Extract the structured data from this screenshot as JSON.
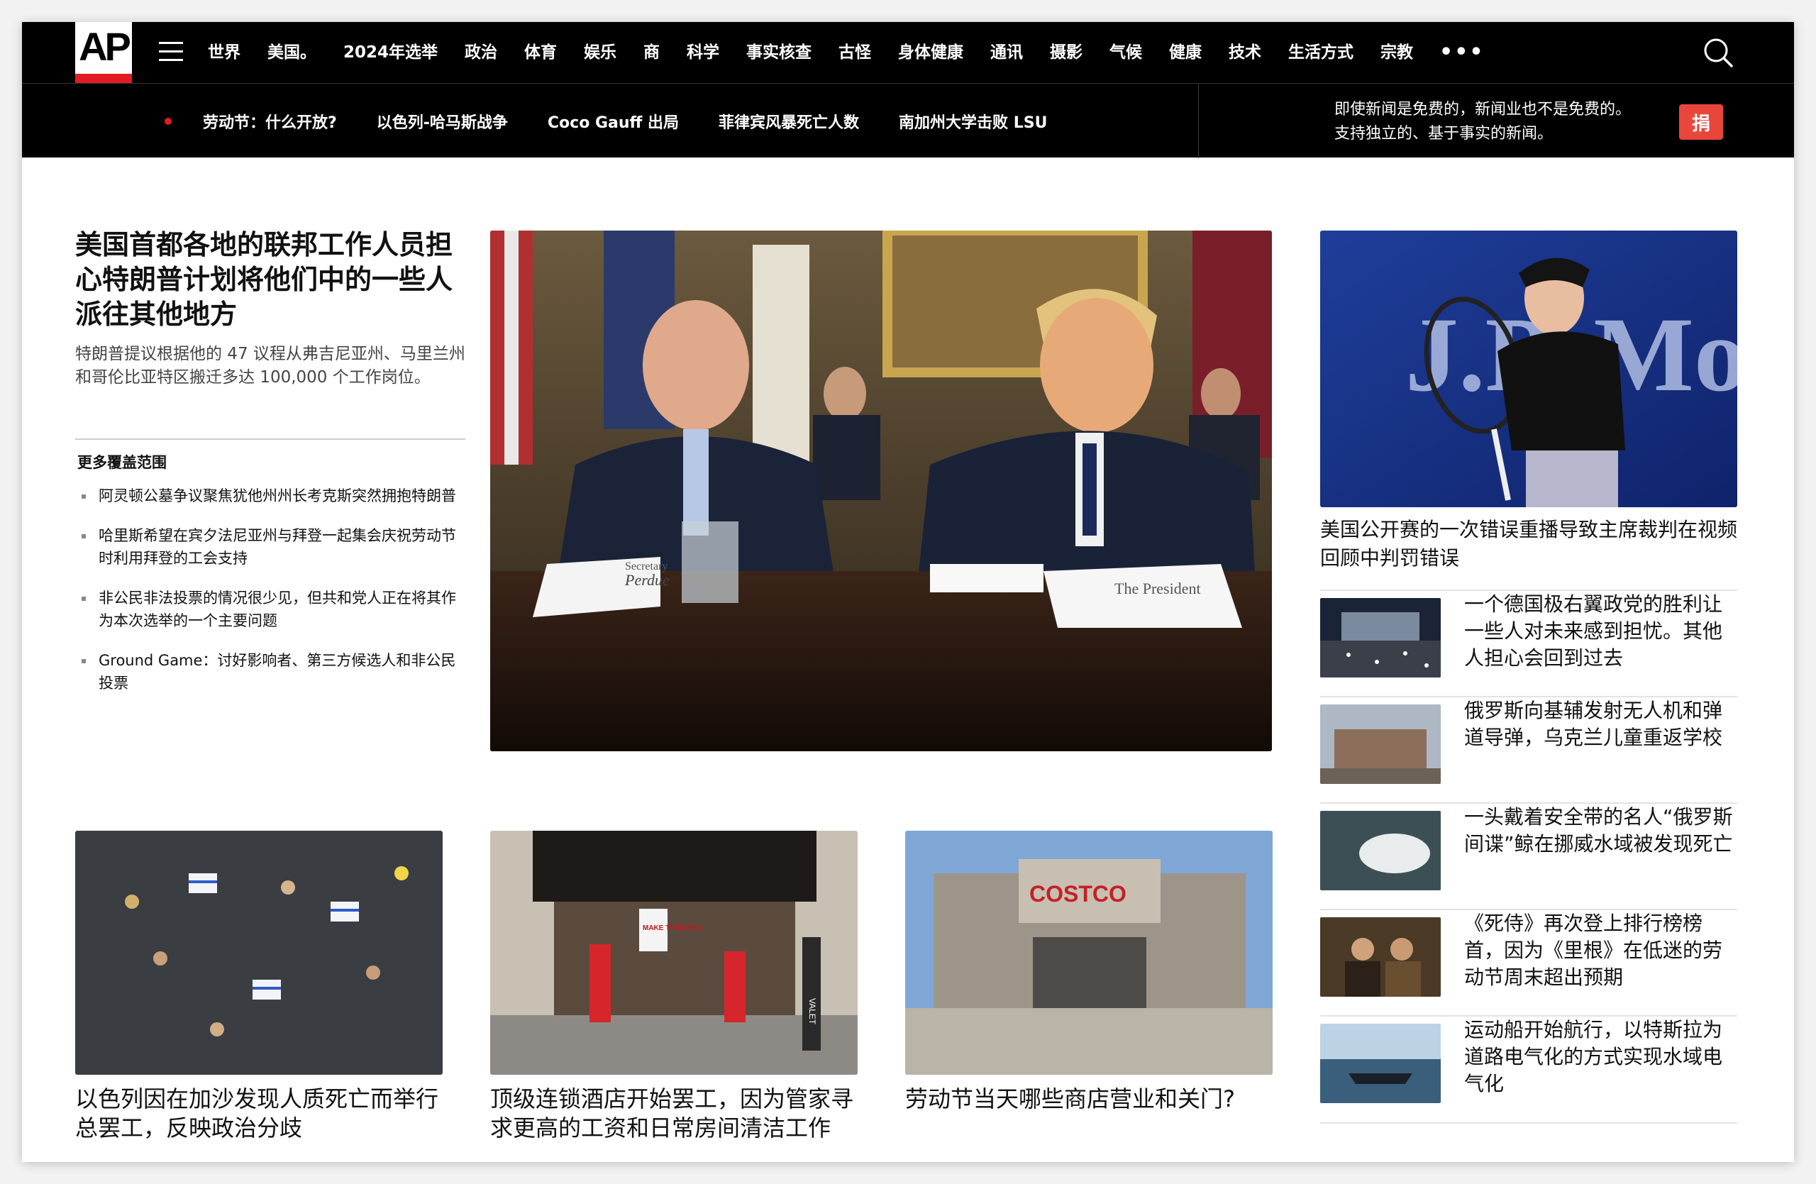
{
  "colors": {
    "nav_bg": "#000000",
    "accent_red": "#e51b23",
    "donate_red": "#e8463a"
  },
  "logo": {
    "text": "AP"
  },
  "nav": {
    "items": [
      "世界",
      "美国。",
      "2024年选举",
      "政治",
      "体育",
      "娱乐",
      "商",
      "科学",
      "事实核查",
      "古怪",
      "身体健康",
      "通讯",
      "摄影",
      "气候",
      "健康",
      "技术",
      "生活方式",
      "宗教"
    ],
    "more": "•••",
    "search_icon": "search-icon"
  },
  "trending": [
    "劳动节：什么开放?",
    "以色列-哈马斯战争",
    "Coco Gauff 出局",
    "菲律宾风暴死亡人数",
    "南加州大学击败 LSU"
  ],
  "donate": {
    "line1": "即使新闻是免费的，新闻业也不是免费的。",
    "line2": "支持独立的、基于事实的新闻。",
    "button": "捐"
  },
  "lead": {
    "headline": "美国首都各地的联邦工作人员担心特朗普计划将他们中的一些人派往其他地方",
    "description": "特朗普提议根据他的 47 议程从弗吉尼亚州、马里兰州和哥伦比亚特区搬迁多达 100,000 个工作岗位。",
    "more_title": "更多覆盖范围",
    "more_items": [
      "阿灵顿公墓争议聚焦犹他州州长考克斯突然拥抱特朗普",
      "哈里斯希望在宾夕法尼亚州与拜登一起集会庆祝劳动节时利用拜登的工会支持",
      "非公民非法投票的情况很少见，但共和党人正在将其作为本次选举的一个主要问题",
      "Ground Game：讨好影响者、第三方候选人和非公民投票"
    ]
  },
  "right": {
    "caption": "美国公开赛的一次错误重播导致主席裁判在视频回顾中判罚错误",
    "items": [
      "一个德国极右翼政党的胜利让一些人对未来感到担忧。其他人担心会回到过去",
      "俄罗斯向基辅发射无人机和弹道导弹，乌克兰儿童重返学校",
      "一头戴着安全带的名人“俄罗斯间谍”鲸在挪威水域被发现死亡",
      "《死侍》再次登上排行榜榜首，因为《里根》在低迷的劳动节周末超出预期",
      "运动船开始航行，以特斯拉为道路电气化的方式实现水域电气化"
    ]
  },
  "bottom": [
    "以色列因在加沙发现人质死亡而举行总罢工，反映政治分歧",
    "顶级连锁酒店开始罢工，因为管家寻求更高的工资和日常房间清洁工作",
    "劳动节当天哪些商店营业和关门?"
  ],
  "photo_text": {
    "sign_secretary": "Secretary",
    "sign_perdue": "Perdue",
    "sign_president": "The President",
    "banner_jp": "J.P. Mor",
    "costco": "COSTCO",
    "strike_sign": "MAKE THEM PAY!",
    "valet": "VALET"
  }
}
